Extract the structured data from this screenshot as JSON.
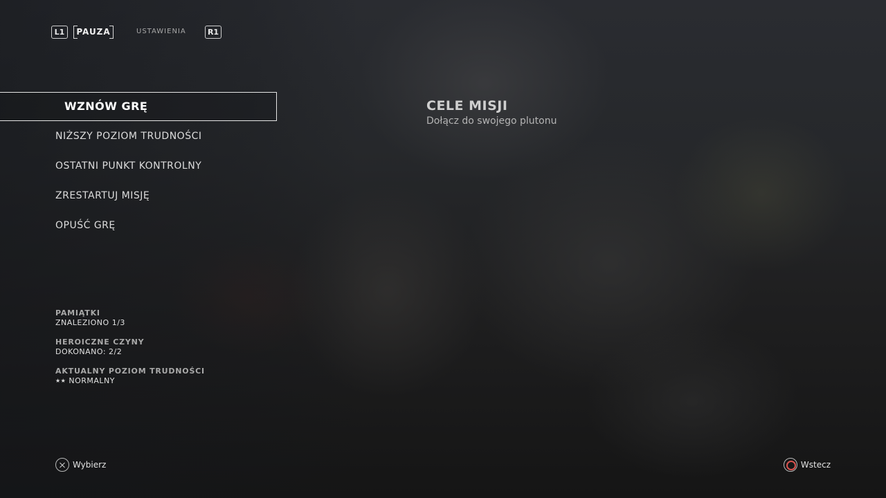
{
  "topbar": {
    "left_bumper": "L1",
    "active_tab": "PAUZA",
    "inactive_tab": "USTAWIENIA",
    "right_bumper": "R1"
  },
  "menu": {
    "items": [
      {
        "label": "WZNÓW GRĘ",
        "selected": true
      },
      {
        "label": "NIŻSZY POZIOM TRUDNOŚCI",
        "selected": false
      },
      {
        "label": "OSTATNI PUNKT KONTROLNY",
        "selected": false
      },
      {
        "label": "ZRESTARTUJ MISJĘ",
        "selected": false
      },
      {
        "label": "OPUŚĆ GRĘ",
        "selected": false
      }
    ]
  },
  "objectives": {
    "title": "CELE MISJI",
    "text": "Dołącz do swojego plutonu"
  },
  "stats": {
    "collectibles": {
      "label": "PAMIĄTKI",
      "value": "ZNALEZIONO 1/3"
    },
    "heroic_acts": {
      "label": "HEROICZNE CZYNY",
      "value": "DOKONANO: 2/2"
    },
    "difficulty": {
      "label": "AKTUALNY POZIOM TRUDNOŚCI",
      "stars": "★★",
      "value": "NORMALNY"
    }
  },
  "footer": {
    "select_icon": "cross-button-icon",
    "select_label": "Wybierz",
    "back_icon": "circle-button-icon",
    "back_label": "Wstecz",
    "back_accent_color": "#d9534f"
  }
}
